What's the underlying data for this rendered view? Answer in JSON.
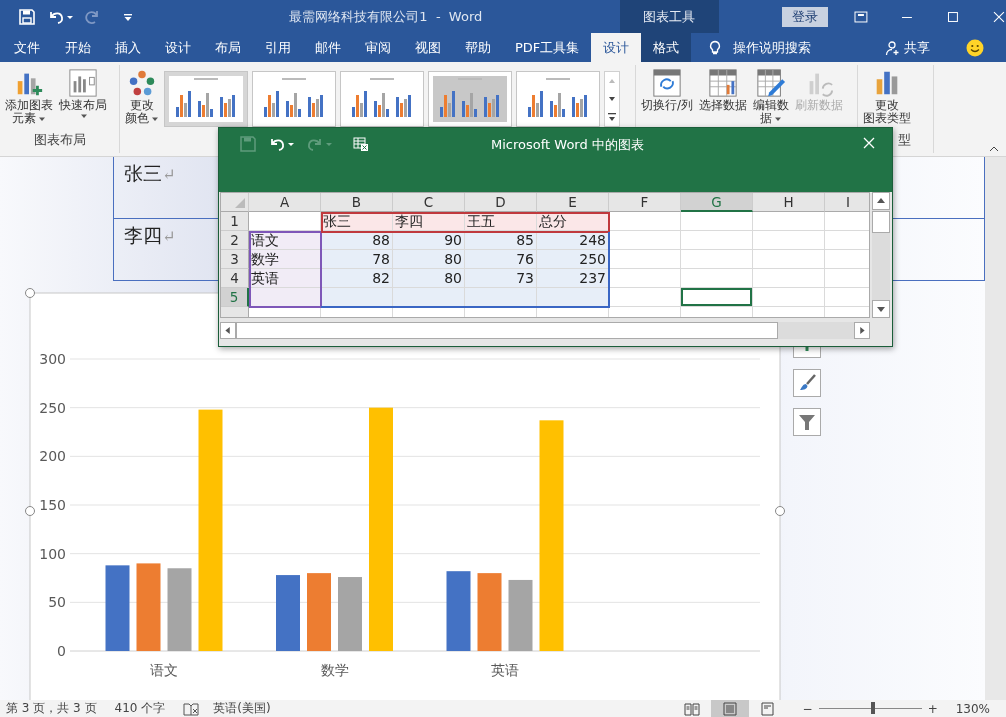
{
  "title_bar": {
    "title": "最需网络科技有限公司1  -  Word",
    "context_label": "图表工具",
    "sign_in": "登录"
  },
  "tabs": [
    {
      "label": "文件",
      "selected": false,
      "context": false
    },
    {
      "label": "开始",
      "selected": false,
      "context": false
    },
    {
      "label": "插入",
      "selected": false,
      "context": false
    },
    {
      "label": "设计",
      "selected": false,
      "context": false
    },
    {
      "label": "布局",
      "selected": false,
      "context": false
    },
    {
      "label": "引用",
      "selected": false,
      "context": false
    },
    {
      "label": "邮件",
      "selected": false,
      "context": false
    },
    {
      "label": "审阅",
      "selected": false,
      "context": false
    },
    {
      "label": "视图",
      "selected": false,
      "context": false
    },
    {
      "label": "帮助",
      "selected": false,
      "context": false
    },
    {
      "label": "PDF工具集",
      "selected": false,
      "context": false
    },
    {
      "label": "设计",
      "selected": true,
      "context": true
    },
    {
      "label": "格式",
      "selected": false,
      "context": true
    }
  ],
  "tell_me": "操作说明搜索",
  "share": "共享",
  "ribbon": {
    "groups": [
      {
        "label": "图表布局",
        "buttons": [
          {
            "kind": "add_element",
            "lines": [
              "添加图表",
              "元素"
            ],
            "dropdown": true,
            "disabled": false
          },
          {
            "kind": "quick_layout",
            "lines": [
              "快速布局"
            ],
            "dropdown": true,
            "disabled": false
          }
        ]
      },
      {
        "buttons": [
          {
            "kind": "colors",
            "lines": [
              "更改",
              "颜色"
            ],
            "dropdown": true,
            "disabled": false
          }
        ],
        "styles": [
          {
            "selected": true
          },
          {
            "selected": false
          },
          {
            "selected": false
          },
          {
            "selected": false
          },
          {
            "selected": false
          }
        ]
      },
      {
        "buttons": [
          {
            "kind": "switch_row_column",
            "lines": [
              "切换行/列"
            ],
            "dropdown": false,
            "disabled": false
          },
          {
            "kind": "select_data",
            "lines": [
              "选择数据"
            ],
            "dropdown": false,
            "disabled": false
          },
          {
            "kind": "edit_data",
            "lines": [
              "编辑数",
              "据"
            ],
            "dropdown": true,
            "disabled": false
          },
          {
            "kind": "refresh_data",
            "lines": [
              "刷新数据"
            ],
            "dropdown": false,
            "disabled": true
          }
        ]
      },
      {
        "label": "型",
        "buttons": [
          {
            "kind": "change_type",
            "lines": [
              "更改",
              "图表类型"
            ],
            "dropdown": false,
            "disabled": false
          }
        ]
      }
    ]
  },
  "document": {
    "table_rows": [
      {
        "text": "张三",
        "mark": "↵"
      },
      {
        "text": "李四",
        "mark": "↵"
      }
    ],
    "chart_data": {
      "type": "bar",
      "categories": [
        "语文",
        "数学",
        "英语"
      ],
      "series": [
        {
          "color": "#4472c4",
          "values": [
            88,
            78,
            82
          ]
        },
        {
          "color": "#ed7d31",
          "values": [
            90,
            80,
            80
          ]
        },
        {
          "color": "#a5a5a5",
          "values": [
            85,
            76,
            73
          ]
        },
        {
          "color": "#ffc000",
          "values": [
            248,
            250,
            237
          ]
        }
      ],
      "grid": true,
      "ylim": [
        0,
        300
      ],
      "yticks": [
        0,
        50,
        100,
        150,
        200,
        250,
        300
      ]
    }
  },
  "popup": {
    "title": "Microsoft Word 中的图表",
    "columns": [
      {
        "label": "A",
        "selected": false
      },
      {
        "label": "B",
        "selected": false
      },
      {
        "label": "C",
        "selected": false
      },
      {
        "label": "D",
        "selected": false
      },
      {
        "label": "E",
        "selected": false
      },
      {
        "label": "F",
        "selected": false
      },
      {
        "label": "G",
        "selected": true
      },
      {
        "label": "H",
        "selected": false
      },
      {
        "label": "I",
        "selected": false
      }
    ],
    "rows": [
      {
        "label": "1",
        "kind": "header",
        "selected": false,
        "cells": [
          null,
          "张三",
          "李四",
          "王五",
          "总分"
        ]
      },
      {
        "label": "2",
        "kind": "data",
        "selected": false,
        "cells": [
          "语文",
          "88",
          "90",
          "85",
          "248"
        ]
      },
      {
        "label": "3",
        "kind": "data",
        "selected": false,
        "cells": [
          "数学",
          "78",
          "80",
          "76",
          "250"
        ]
      },
      {
        "label": "4",
        "kind": "data",
        "selected": false,
        "cells": [
          "英语",
          "82",
          "80",
          "73",
          "237"
        ]
      },
      {
        "label": "5",
        "selected": true
      }
    ]
  },
  "status_bar": {
    "page": "第 3 页，共 3 页",
    "words": "410 个字",
    "language": "英语(美国)",
    "views": [
      {
        "kind": "read",
        "selected": false
      },
      {
        "kind": "print",
        "selected": true
      },
      {
        "kind": "web",
        "selected": false
      }
    ],
    "zoom": {
      "minus": "−",
      "plus": "+",
      "level": 0.53,
      "reading": "130%"
    }
  }
}
